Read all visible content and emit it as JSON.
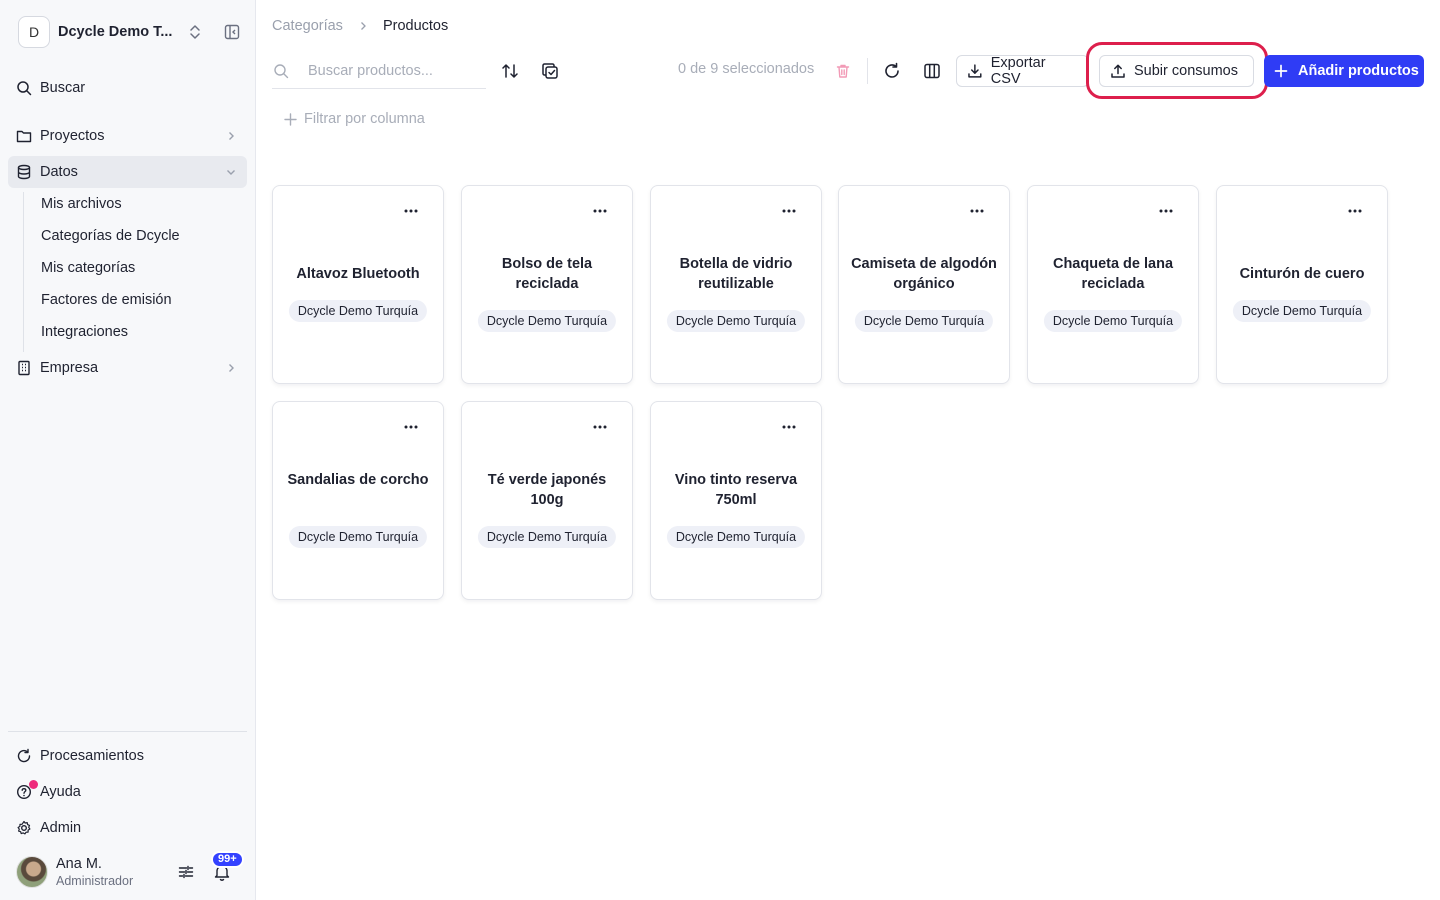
{
  "sidebar": {
    "workspace": {
      "initial": "D",
      "name": "Dcycle Demo T..."
    },
    "search_label": "Buscar",
    "proyectos_label": "Proyectos",
    "datos_label": "Datos",
    "datos_subitems": [
      "Mis archivos",
      "Categorías de Dcycle",
      "Mis categorías",
      "Factores de emisión",
      "Integraciones"
    ],
    "empresa_label": "Empresa",
    "bottom": {
      "procesamientos_label": "Procesamientos",
      "ayuda_label": "Ayuda",
      "admin_label": "Admin"
    },
    "user": {
      "name": "Ana M.",
      "role": "Administrador",
      "notifications_badge": "99+"
    }
  },
  "breadcrumb": {
    "parent": "Categorías",
    "current": "Productos"
  },
  "toolbar": {
    "search_placeholder": "Buscar productos...",
    "selection_text": "0 de 9 seleccionados",
    "export_label": "Exportar CSV",
    "upload_label": "Subir consumos",
    "add_label": "Añadir productos",
    "filter_label": "Filtrar por columna"
  },
  "products": [
    {
      "name": "Altavoz Bluetooth",
      "tag": "Dcycle Demo Turquía"
    },
    {
      "name": "Bolso de tela reciclada",
      "tag": "Dcycle Demo Turquía"
    },
    {
      "name": "Botella de vidrio reutilizable",
      "tag": "Dcycle Demo Turquía"
    },
    {
      "name": "Camiseta de algodón orgánico",
      "tag": "Dcycle Demo Turquía"
    },
    {
      "name": "Chaqueta de lana reciclada",
      "tag": "Dcycle Demo Turquía"
    },
    {
      "name": "Cinturón de cuero",
      "tag": "Dcycle Demo Turquía"
    },
    {
      "name": "Sandalias de corcho",
      "tag": "Dcycle Demo Turquía"
    },
    {
      "name": "Té verde japonés 100g",
      "tag": "Dcycle Demo Turquía"
    },
    {
      "name": "Vino tinto reserva 750ml",
      "tag": "Dcycle Demo Turquía"
    }
  ],
  "colors": {
    "primary": "#2f3cf5",
    "highlight": "#dd1f4c",
    "tag_bg": "#eef0f7",
    "notification_dot": "#ee2a7b"
  }
}
